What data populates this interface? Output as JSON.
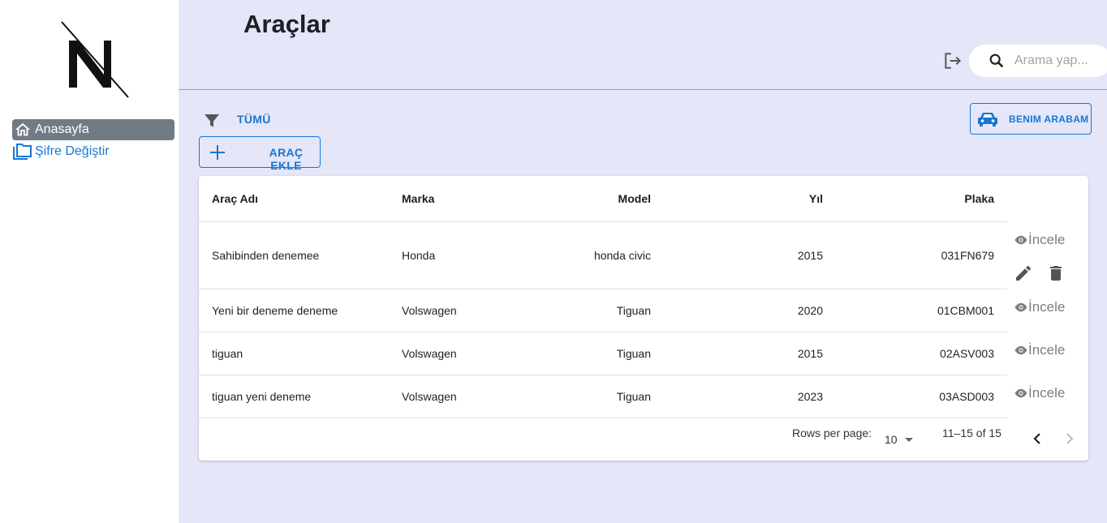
{
  "sidebar": {
    "logo_text": "N",
    "items": [
      {
        "label": "Anasayfa",
        "icon": "home-icon",
        "active": true
      },
      {
        "label": "Şifre Değiştir",
        "icon": "folders-icon",
        "active": false
      }
    ]
  },
  "header": {
    "title": "Araçlar",
    "search_placeholder": "Arama yap..."
  },
  "toolbar": {
    "filter_label": "TÜMÜ",
    "add_label": "ARAÇ EKLE",
    "my_car_label": "BENIM ARABAM"
  },
  "table": {
    "columns": [
      "Araç Adı",
      "Marka",
      "Model",
      "Yıl",
      "Plaka"
    ],
    "rows": [
      {
        "name": "Sahibinden denemee",
        "marka": "Honda",
        "model": "honda civic",
        "yil": "2015",
        "plaka": "031FN679"
      },
      {
        "name": "Yeni bir deneme deneme",
        "marka": "Volswagen",
        "model": "Tiguan",
        "yil": "2020",
        "plaka": "01CBM001"
      },
      {
        "name": "tiguan",
        "marka": "Volswagen",
        "model": "Tiguan",
        "yil": "2015",
        "plaka": "02ASV003"
      },
      {
        "name": "tiguan yeni deneme",
        "marka": "Volswagen",
        "model": "Tiguan",
        "yil": "2023",
        "plaka": "03ASD003"
      }
    ],
    "action_label": "İncele"
  },
  "pagination": {
    "rows_per_page_label": "Rows per page:",
    "rows_per_page_value": "10",
    "range_label": "11–15 of 15"
  },
  "colors": {
    "accent": "#1976d2",
    "main_bg": "#e5e6f8",
    "active_nav_bg": "#707b86"
  }
}
